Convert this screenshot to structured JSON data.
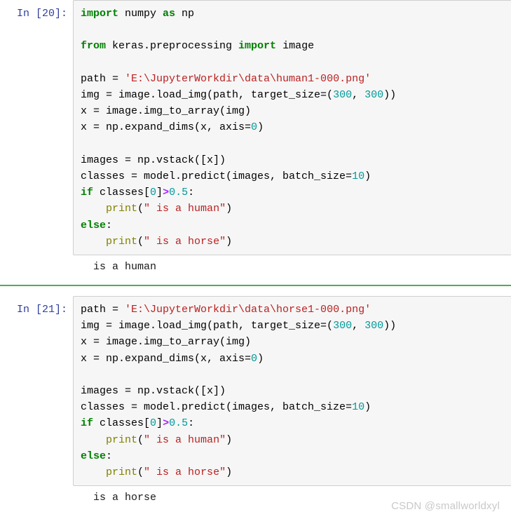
{
  "notebook": {
    "cells": [
      {
        "prompt": "In [20]:",
        "code_lines": [
          [
            {
              "t": "import",
              "c": "kw"
            },
            {
              "t": " numpy ",
              "c": "plain"
            },
            {
              "t": "as",
              "c": "kw"
            },
            {
              "t": " np",
              "c": "plain"
            }
          ],
          [],
          [
            {
              "t": "from",
              "c": "kw"
            },
            {
              "t": " keras.preprocessing ",
              "c": "plain"
            },
            {
              "t": "import",
              "c": "kw"
            },
            {
              "t": " image",
              "c": "plain"
            }
          ],
          [],
          [
            {
              "t": "path = ",
              "c": "plain"
            },
            {
              "t": "'E:\\JupyterWorkdir\\data\\human1-000.png'",
              "c": "str"
            }
          ],
          [
            {
              "t": "img = image.load_img(path, target_size=(",
              "c": "plain"
            },
            {
              "t": "300",
              "c": "num"
            },
            {
              "t": ", ",
              "c": "plain"
            },
            {
              "t": "300",
              "c": "num"
            },
            {
              "t": "))",
              "c": "plain"
            }
          ],
          [
            {
              "t": "x = image.img_to_array(img)",
              "c": "plain"
            }
          ],
          [
            {
              "t": "x = np.expand_dims(x, axis=",
              "c": "plain"
            },
            {
              "t": "0",
              "c": "num"
            },
            {
              "t": ")",
              "c": "plain"
            }
          ],
          [],
          [
            {
              "t": "images = np.vstack([x])",
              "c": "plain"
            }
          ],
          [
            {
              "t": "classes = model.predict(images, batch_size=",
              "c": "plain"
            },
            {
              "t": "10",
              "c": "num"
            },
            {
              "t": ")",
              "c": "plain"
            }
          ],
          [
            {
              "t": "if",
              "c": "kw"
            },
            {
              "t": " classes[",
              "c": "plain"
            },
            {
              "t": "0",
              "c": "num"
            },
            {
              "t": "]",
              "c": "plain"
            },
            {
              "t": ">",
              "c": "op"
            },
            {
              "t": "0.5",
              "c": "num"
            },
            {
              "t": ":",
              "c": "plain"
            }
          ],
          [
            {
              "t": "    ",
              "c": "plain"
            },
            {
              "t": "print",
              "c": "fn"
            },
            {
              "t": "(",
              "c": "plain"
            },
            {
              "t": "\" is a human\"",
              "c": "str"
            },
            {
              "t": ")",
              "c": "plain"
            }
          ],
          [
            {
              "t": "else",
              "c": "kw"
            },
            {
              "t": ":",
              "c": "plain"
            }
          ],
          [
            {
              "t": "    ",
              "c": "plain"
            },
            {
              "t": "print",
              "c": "fn"
            },
            {
              "t": "(",
              "c": "plain"
            },
            {
              "t": "\" is a horse\"",
              "c": "str"
            },
            {
              "t": ")",
              "c": "plain"
            }
          ]
        ],
        "output": " is a human"
      },
      {
        "prompt": "In [21]:",
        "code_lines": [
          [
            {
              "t": "path = ",
              "c": "plain"
            },
            {
              "t": "'E:\\JupyterWorkdir\\data\\horse1-000.png'",
              "c": "str"
            }
          ],
          [
            {
              "t": "img = image.load_img(path, target_size=(",
              "c": "plain"
            },
            {
              "t": "300",
              "c": "num"
            },
            {
              "t": ", ",
              "c": "plain"
            },
            {
              "t": "300",
              "c": "num"
            },
            {
              "t": "))",
              "c": "plain"
            }
          ],
          [
            {
              "t": "x = image.img_to_array(img)",
              "c": "plain"
            }
          ],
          [
            {
              "t": "x = np.expand_dims(x, axis=",
              "c": "plain"
            },
            {
              "t": "0",
              "c": "num"
            },
            {
              "t": ")",
              "c": "plain"
            }
          ],
          [],
          [
            {
              "t": "images = np.vstack([x])",
              "c": "plain"
            }
          ],
          [
            {
              "t": "classes = model.predict(images, batch_size=",
              "c": "plain"
            },
            {
              "t": "10",
              "c": "num"
            },
            {
              "t": ")",
              "c": "plain"
            }
          ],
          [
            {
              "t": "if",
              "c": "kw"
            },
            {
              "t": " classes[",
              "c": "plain"
            },
            {
              "t": "0",
              "c": "num"
            },
            {
              "t": "]",
              "c": "plain"
            },
            {
              "t": ">",
              "c": "op"
            },
            {
              "t": "0.5",
              "c": "num"
            },
            {
              "t": ":",
              "c": "plain"
            }
          ],
          [
            {
              "t": "    ",
              "c": "plain"
            },
            {
              "t": "print",
              "c": "fn"
            },
            {
              "t": "(",
              "c": "plain"
            },
            {
              "t": "\" is a human\"",
              "c": "str"
            },
            {
              "t": ")",
              "c": "plain"
            }
          ],
          [
            {
              "t": "else",
              "c": "kw"
            },
            {
              "t": ":",
              "c": "plain"
            }
          ],
          [
            {
              "t": "    ",
              "c": "plain"
            },
            {
              "t": "print",
              "c": "fn"
            },
            {
              "t": "(",
              "c": "plain"
            },
            {
              "t": "\" is a horse\"",
              "c": "str"
            },
            {
              "t": ")",
              "c": "plain"
            }
          ]
        ],
        "output": " is a horse"
      }
    ]
  },
  "watermark": {
    "text": "CSDN @smallworldxyl"
  },
  "colors": {
    "keyword": "#008000",
    "string": "#BA2121",
    "number": "#009999",
    "operator": "#AA22FF",
    "function": "#808000",
    "prompt": "#303F9F",
    "divider": "#4CAF50",
    "cell_background": "#f6f6f6",
    "cell_border": "#cfcfcf"
  }
}
